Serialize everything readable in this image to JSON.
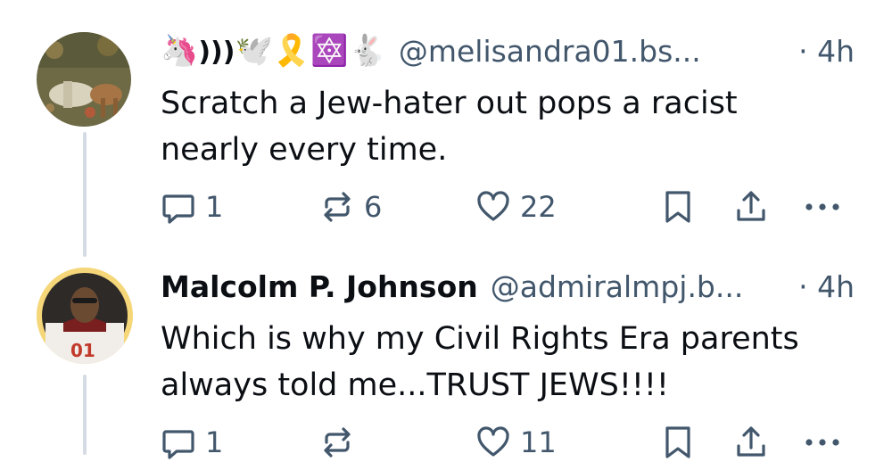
{
  "posts": [
    {
      "emoji_name": [
        "🦄",
        ")))",
        "🕊️",
        "🎗️",
        "🔯",
        "🐇"
      ],
      "display_name": "",
      "handle": "@melisandra01.bs...",
      "time": "· 4h",
      "text_line1": "Scratch a Jew-hater out pops a racist",
      "text_line2": "nearly every time.",
      "replies": "1",
      "reposts": "6",
      "likes": "22"
    },
    {
      "display_name": "Malcolm P. Johnson",
      "handle": "@admiralmpj.b...",
      "time": "· 4h",
      "text_line1": "Which is why my Civil Rights Era parents",
      "text_line2": "always told me...TRUST JEWS!!!!",
      "replies": "1",
      "reposts": "",
      "likes": "11"
    }
  ],
  "icons": {
    "reply": "speech-bubble-icon",
    "repost": "repost-arrows-icon",
    "like": "heart-icon",
    "bookmark": "bookmark-icon",
    "share": "share-upload-icon",
    "more": "ellipsis-icon"
  },
  "colors": {
    "text": "#0b0f14",
    "muted": "#42576c",
    "thread_line": "#d4dbe2",
    "avatar2_ring": "#f5d77a"
  }
}
